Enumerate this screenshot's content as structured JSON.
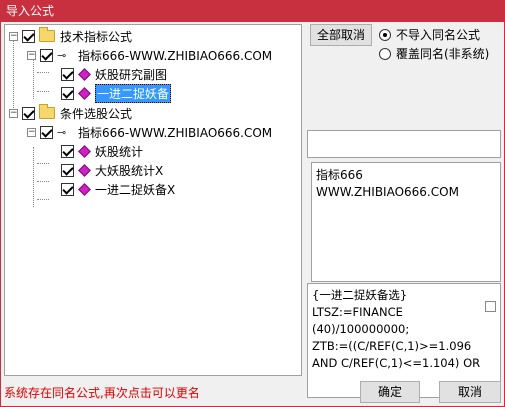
{
  "window": {
    "title": "导入公式"
  },
  "tree": {
    "groups": [
      {
        "label": "技术指标公式",
        "checked": true,
        "child": {
          "label": "指标666-WWW.ZHIBIAO666.COM",
          "checked": true,
          "items": [
            {
              "label": "妖股研究副图",
              "checked": true,
              "selected": false
            },
            {
              "label": "一进二捉妖备",
              "checked": true,
              "selected": true
            }
          ]
        }
      },
      {
        "label": "条件选股公式",
        "checked": true,
        "child": {
          "label": "指标666-WWW.ZHIBIAO666.COM",
          "checked": true,
          "items": [
            {
              "label": "妖股统计",
              "checked": true,
              "selected": false
            },
            {
              "label": "大妖股统计X",
              "checked": true,
              "selected": false
            },
            {
              "label": "一进二捉妖备X",
              "checked": true,
              "selected": false
            }
          ]
        }
      }
    ]
  },
  "right": {
    "cancel_all_label": "全部取消",
    "options": [
      {
        "label": "不导入同名公式",
        "selected": true
      },
      {
        "label": "覆盖同名(非系统)",
        "selected": false
      }
    ],
    "info_lines": [
      "指标666",
      "WWW.ZHIBIAO666.COM"
    ],
    "code_lines": [
      "{一进二捉妖备选}",
      "LTSZ:=FINANCE",
      "(40)/100000000;",
      "ZTB:=((C/REF(C,1)>=1.096",
      "AND C/REF(C,1)<=1.104) OR"
    ]
  },
  "footer": {
    "status": "系统存在同名公式,再次点击可以更名",
    "ok_label": "确定",
    "cancel_label": "取消"
  },
  "colors": {
    "title_bar": "#c9303f",
    "status_text": "#e00000",
    "selection": "#3399ff",
    "diamond": "#d01fc4"
  }
}
